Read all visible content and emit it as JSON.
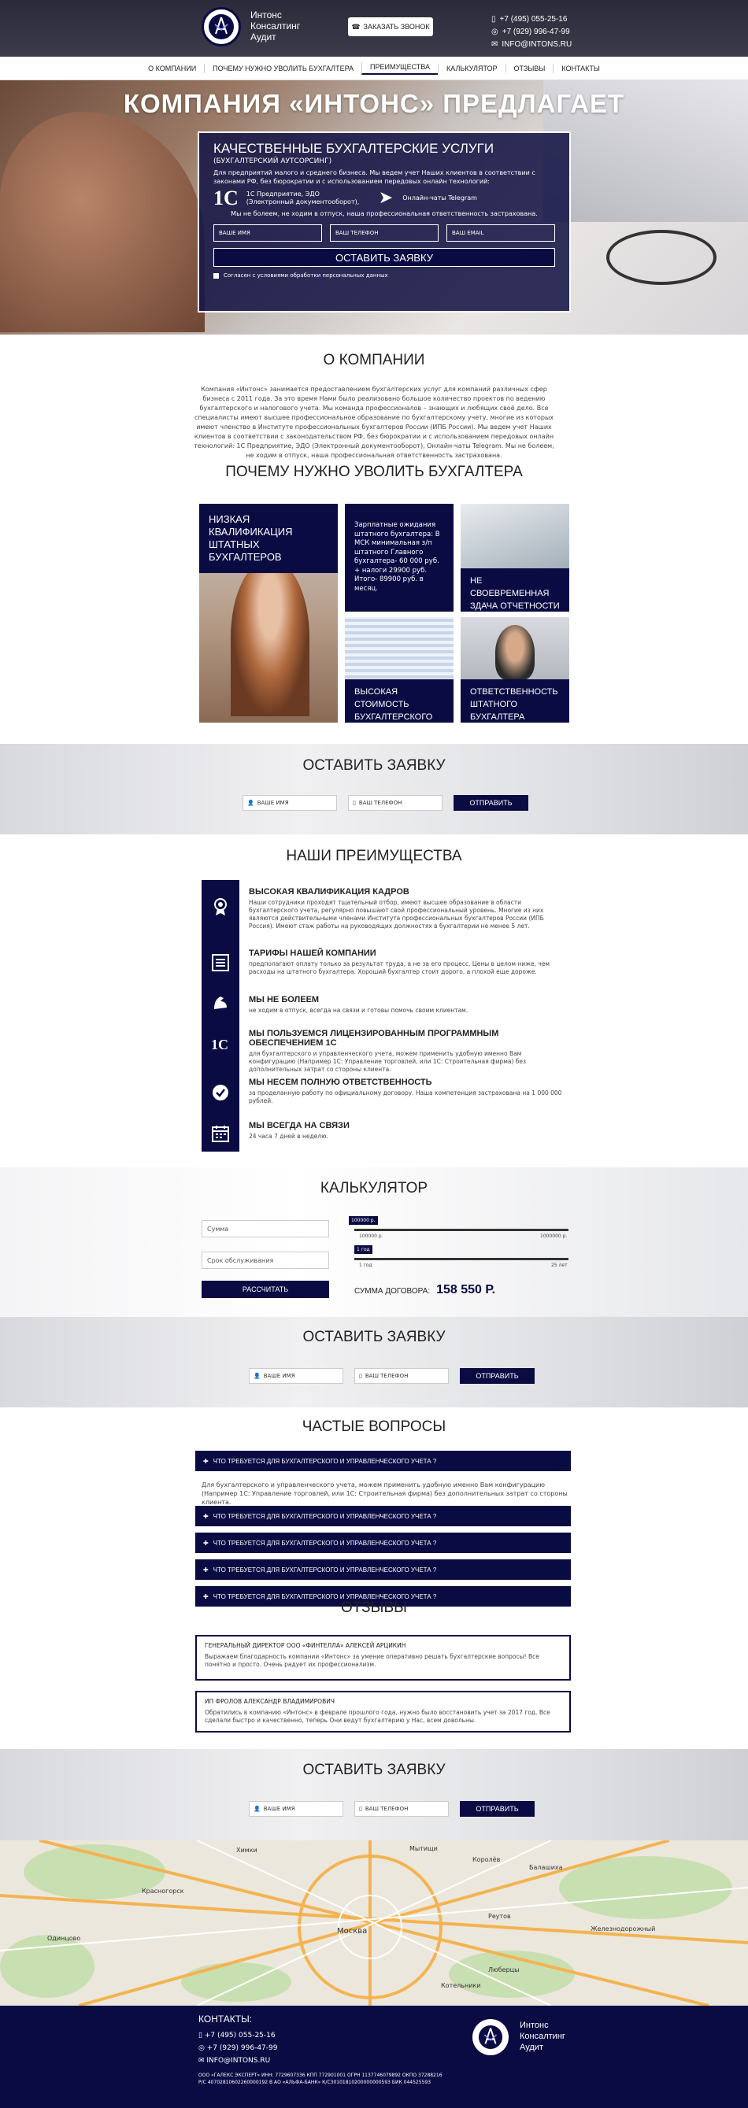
{
  "header": {
    "brand_lines": [
      "Интонс",
      "Консалтинг",
      "Аудит"
    ],
    "call_button": "Заказать звонок",
    "phone1": "+7 (495) 055-25-16",
    "phone2": "+7 (929) 996-47-99",
    "email": "INFO@INTONS.RU"
  },
  "nav": {
    "items": [
      "О компании",
      "Почему нужно уволить бухгалтера",
      "Преимущества",
      "Калькулятор",
      "Отзывы",
      "Контакты"
    ],
    "active_index": 2
  },
  "hero": {
    "title": "Компания «Интонс» предлагает",
    "box_title": "Качественные бухгалтерские услуги",
    "box_sub": "(бухгалтерский аутсорсинг)",
    "box_text": "Для предприятий малого и среднего бизнеса. Мы ведем учет Наших клиентов в соответствии с законами РФ, без бюрократии и с использованием передовых онлайн технологий:",
    "logo_1c": "1С",
    "feature1": "1С Предприятие, ЭДО (Электронный документооборот),",
    "feature2": "Онлайн-чаты Telegram",
    "note": "Мы не болеем, не ходим в отпуск, наша профессиональная ответственность застрахована.",
    "input_name": "Ваше имя",
    "input_phone": "Ваш телефон",
    "input_email": "Ваш email",
    "submit": "Оставить заявку",
    "agree": "Согласен с условиями обработки персональных данных"
  },
  "about": {
    "title": "О компании",
    "text": "Компания «Интонс» занимается предоставлением бухгалтерских услуг для компаний различных сфер бизнеса с 2011 года. За это время Нами было реализовано большое количество проектов по ведению бухгалтерского и налогового учета. Мы команда профессионалов – знающих и любящих своё дело. Все специалисты имеют высшее профессиональное образование по бухгалтерскому учету, многие из которых имеют членство в Институте профессиональных бухгалтеров России (ИПБ России). Мы ведем учет Наших клиентов в соответствии с законодательством РФ, без бюрократии и с использованием передовых онлайн технологий: 1С Предприятие, ЭДО (Электронный документооборот), Онлайн-чаты Telegram. Мы не болеем, не ходим в отпуск, наша профессиональная ответственность застрахована."
  },
  "why": {
    "title": "Почему нужно уволить бухгалтера",
    "tile1": "Низкая квалификация штатных бухгалтеров",
    "tile2": "Зарплатные ожидания штатного бухгалтера: В МСК минимальная з/п штатного Главного бухгалтера- 60 000 руб. + налоги 29900 руб. Итого- 89900 руб. в месяц.",
    "tile3": "Не своевременная здача отчетности",
    "tile4": "Высокая стоимость бухгалтерского ПО",
    "tile5": "Ответственность штатного бухгалтера"
  },
  "form1": {
    "title": "Оставить заявку",
    "name": "Ваше имя",
    "phone": "Ваш телефон",
    "button": "Отправить"
  },
  "advantages": {
    "title": "Наши преимущества",
    "items": [
      {
        "icon": "award-icon",
        "title": "Высокая квалификация кадров",
        "text": "Наши сотрудники проходят тщательный отбор, имеют высшее образование в области бухгалтерского учета, регулярно повышают свой профессиональный уровень. Многие из них являются действительными членами Института профессиональных бухгалтеров России (ИПБ Россия). Имеют стаж работы на руководящих должностях в бухгалтерии не менее 5 лет."
      },
      {
        "icon": "list-icon",
        "title": "Тарифы нашей компании",
        "text": "предполагают оплату только за результат труда, а не за его процесс. Цены в целом ниже, чем расходы на штатного бухгалтера. Хороший бухгалтер стоит дорого, а плохой еще дороже."
      },
      {
        "icon": "strength-icon",
        "title": "Мы не болеем",
        "text": "не ходим в отпуск, всегда на связи и готовы помочь своим клиентам."
      },
      {
        "icon": "1c-icon",
        "title": "Мы пользуемся лицензированным программным обеспечением 1С",
        "text": "для бухгалтерского и управленческого учета, можем применить удобную именно Вам конфигурацию (Например 1С: Управление торговлей, или 1С: Строительная фирма) без дополнительных затрат со стороны клиента."
      },
      {
        "icon": "shield-check-icon",
        "title": "Мы несем полную ответственность",
        "text": "за проделанную работу по официальному договору. Наша компетенция застрахована на 1 000 000 рублей."
      },
      {
        "icon": "calendar-icon",
        "title": "Мы всегда на связи",
        "text": "24 часа 7 дней в неделю."
      }
    ]
  },
  "calc": {
    "title": "Калькулятор",
    "sum_placeholder": "Сумма",
    "term_placeholder": "Срок обслуживания",
    "button": "Рассчитать",
    "slider1_value_label": "100000 р.",
    "slider1_min": "100000 р.",
    "slider1_max": "1000000 р.",
    "slider1_fraction": 0.0,
    "slider2_value_label": "1 год",
    "slider2_min": "1 год",
    "slider2_max": "25 лет",
    "slider2_fraction": 0.0,
    "total_label": "Сумма договора:",
    "total_value": "158 550 Р."
  },
  "form2": {
    "title": "Оставить заявку",
    "name": "Ваше имя",
    "phone": "Ваш телефон",
    "button": "Отправить"
  },
  "faq": {
    "title": "Частые вопросы",
    "q1": "Что требуется для бухгалтерского и управленческого учета ?",
    "a1": "Для бухгалтерского и управленческого учета, можем применить удобную именно Вам конфигурацию (Например 1С: Управление торговлей, или 1С: Строительная фирма) без дополнительных затрат со стороны клиента.",
    "q2": "Что требуется для бухгалтерского и управленческого учета ?",
    "q3": "Что требуется для бухгалтерского и управленческого учета ?",
    "q4": "Что требуется для бухгалтерского и управленческого учета ?",
    "q5": "Что требуется для бухгалтерского и управленческого учета ?"
  },
  "reviews": {
    "title": "Отзывы",
    "r1_author": "Генеральный директор ООО «Финтелла» Алексей Арцикин",
    "r1_text": "Выражаем благодарность компании «Интонс» за умение оперативно решать бухгалтерские вопросы! Все понятно и просто. Очень радует их профессионализм.",
    "r2_author": "ИП Фролов Александр Владимирович",
    "r2_text": "Обратились в компанию «Интонс» в феврале прошлого года, нужно было восстановить учет за 2017 год. Все сделали быстро и качественно, теперь Они ведут бухгалтерию у Нас, всем довольны."
  },
  "form3": {
    "title": "Оставить заявку",
    "name": "Ваше имя",
    "phone": "Ваш телефон",
    "button": "Отправить"
  },
  "map": {
    "labels": [
      "Москва",
      "Балашиха",
      "Реутов",
      "Люберцы",
      "Химки",
      "Мытищи",
      "Королёв",
      "Котельники",
      "Одинцово",
      "Красногорск",
      "Железнодорожный"
    ]
  },
  "footer": {
    "contacts_title": "Контакты:",
    "phone1": "+7 (495) 055-25-16",
    "phone2": "+7 (929) 996-47-99",
    "email": "INFO@INTONS.RU",
    "req1": "ООО «ГАЛЕКС ЭКСПЕРТ» ИНН: 7729607336 КПП 772901001 ОГРН 1137746079892 ОКПО 37288216",
    "req2": "Р/С 40702810602260000192 В АО «АЛЬФА-БАНК» К/С30101810200000000593 БИК 044525593",
    "brand_lines": [
      "Интонс",
      "Консалтинг",
      "Аудит"
    ]
  }
}
